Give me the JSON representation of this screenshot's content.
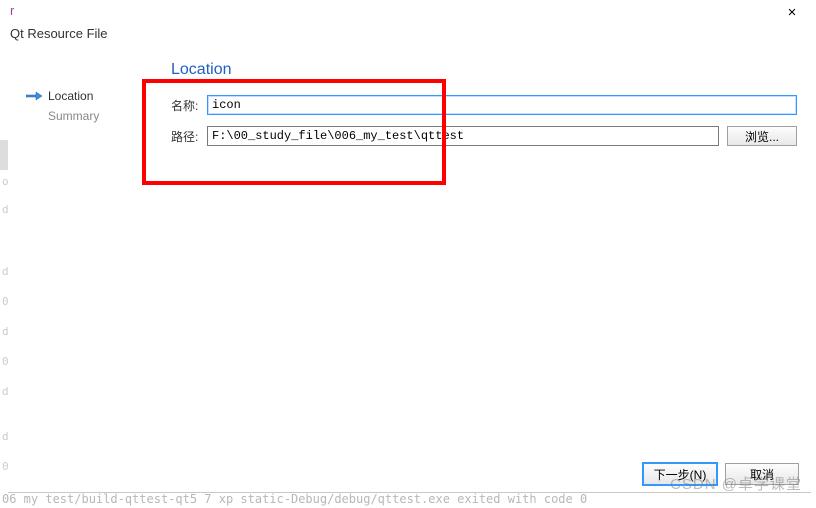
{
  "title_prefix": "r",
  "subtitle": "Qt Resource File",
  "close_label": "×",
  "sidebar": {
    "step_active": "Location",
    "step_inactive": "Summary"
  },
  "content": {
    "heading": "Location",
    "name_label": "名称:",
    "name_value": "icon",
    "path_label": "路径:",
    "path_value": "F:\\00_study_file\\006_my_test\\qttest",
    "browse_label": "浏览..."
  },
  "buttons": {
    "next": "下一步(N)",
    "cancel": "取消"
  },
  "background": {
    "bottom_line": "06 my test/build-qttest-qt5 7 xp static-Debug/debug/qttest.exe exited with code 0",
    "watermark": "CSDN @卓学课堂"
  },
  "ghost_marks": [
    "o",
    "d",
    "d",
    "0",
    "d",
    "0",
    "d",
    "d",
    "0"
  ]
}
